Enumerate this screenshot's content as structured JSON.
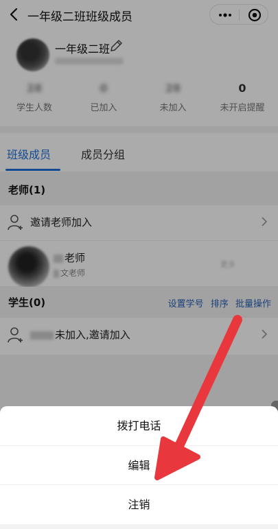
{
  "header": {
    "title": "一年级二班班级成员"
  },
  "class_info": {
    "name": "一年级二班"
  },
  "stats": [
    {
      "value": "28",
      "label": "学生人数"
    },
    {
      "value": "0",
      "label": "已加入"
    },
    {
      "value": "28",
      "label": "未加入"
    },
    {
      "value": "0",
      "label": "未开启提醒"
    }
  ],
  "tabs": [
    {
      "label": "班级成员"
    },
    {
      "label": "成员分组"
    }
  ],
  "teachers_section": {
    "title": "老师(1)",
    "invite_label": "邀请老师加入",
    "teacher": {
      "name_suffix": "老师",
      "subtitle_suffix": "文老师",
      "more": "更多"
    }
  },
  "students_section": {
    "title": "学生(0)",
    "actions": [
      "设置学号",
      "排序",
      "批量操作"
    ],
    "invite_label": "未加入,邀请加入"
  },
  "action_sheet": {
    "items": [
      "拨打电话",
      "编辑",
      "注销"
    ]
  },
  "colors": {
    "accent": "#1e6fd9",
    "link": "#2a62b8",
    "arrow": "#e8383d"
  },
  "icons": {
    "back": "chevron-left-icon",
    "more": "more-dots-icon",
    "target": "target-icon",
    "edit": "pencil-icon",
    "user": "user-add-icon",
    "chevron": "chevron-right-icon"
  }
}
